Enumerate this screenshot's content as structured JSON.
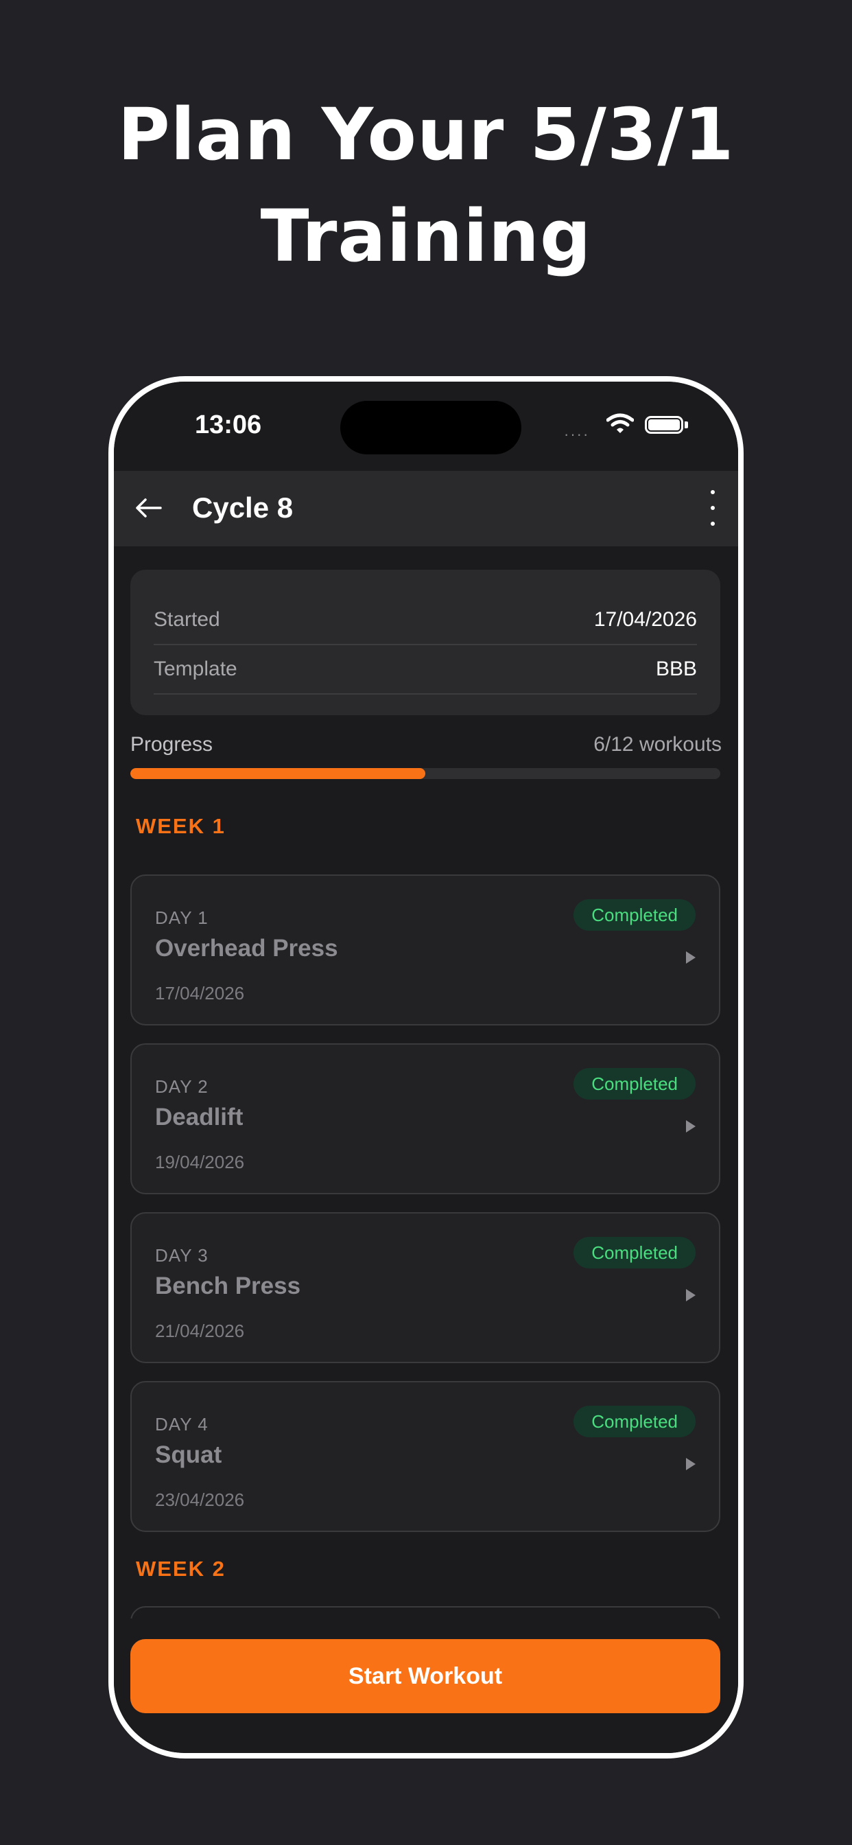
{
  "headline": {
    "line1": "Plan Your 5/3/1",
    "line2": "Training"
  },
  "status_bar": {
    "time": "13:06",
    "signal": "····"
  },
  "app_bar": {
    "title": "Cycle 8"
  },
  "info": {
    "started_label": "Started",
    "started_value": "17/04/2026",
    "template_label": "Template",
    "template_value": "BBB"
  },
  "progress": {
    "label": "Progress",
    "count": "6/12 workouts",
    "fraction": 0.5
  },
  "weeks": [
    {
      "title": "WEEK 1",
      "days": [
        {
          "label": "DAY 1",
          "name": "Overhead Press",
          "date": "17/04/2026",
          "status": "Completed"
        },
        {
          "label": "DAY 2",
          "name": "Deadlift",
          "date": "19/04/2026",
          "status": "Completed"
        },
        {
          "label": "DAY 3",
          "name": "Bench Press",
          "date": "21/04/2026",
          "status": "Completed"
        },
        {
          "label": "DAY 4",
          "name": "Squat",
          "date": "23/04/2026",
          "status": "Completed"
        }
      ]
    },
    {
      "title": "WEEK 2"
    }
  ],
  "cta": {
    "label": "Start Workout"
  },
  "colors": {
    "accent": "#f97316",
    "completed_bg": "#16382a",
    "completed_text": "#4ade80",
    "background": "#222226"
  },
  "icons": [
    "back-arrow-icon",
    "more-vert-icon",
    "wifi-icon",
    "battery-icon",
    "chevron-right-icon"
  ]
}
